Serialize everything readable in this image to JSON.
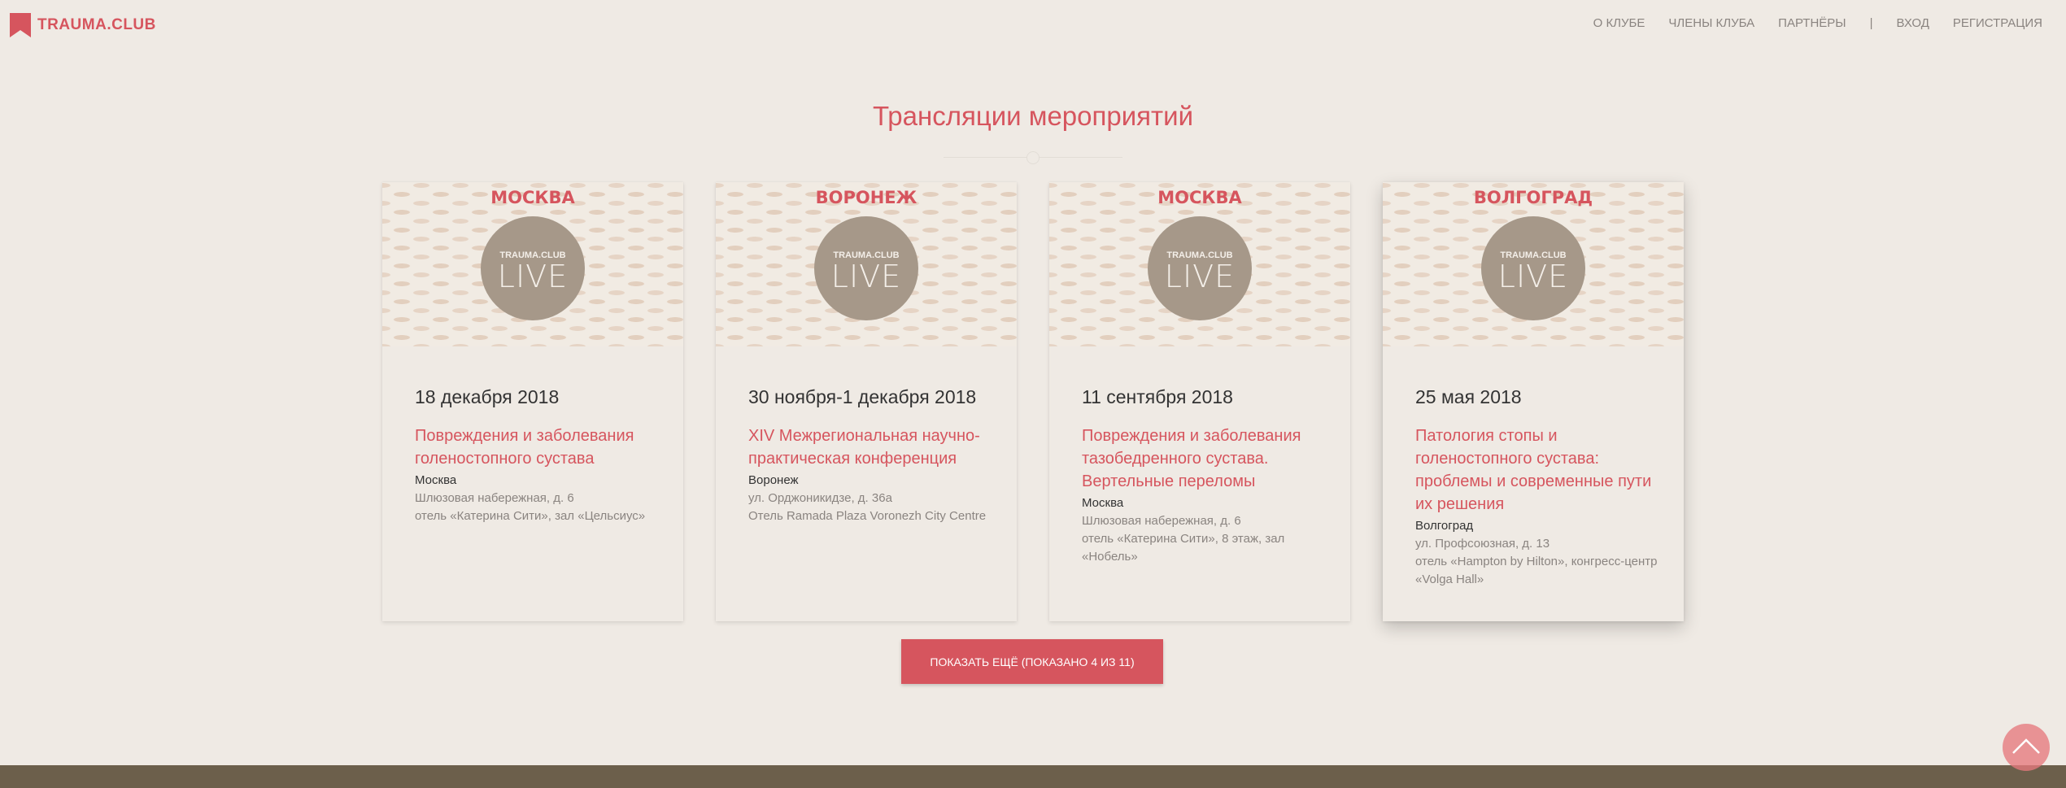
{
  "header": {
    "logo_text": "TRAUMA.CLUB",
    "logo_icon": "bookmark-icon",
    "nav": {
      "about": "О КЛУБЕ",
      "members": "ЧЛЕНЫ КЛУБА",
      "partners": "ПАРТНЁРЫ",
      "separator": "|",
      "login": "ВХОД",
      "register": "РЕГИСТРАЦИЯ"
    }
  },
  "main": {
    "title": "Трансляции мероприятий",
    "cards": [
      {
        "banner_city": "МОСКВА",
        "badge_brand": "TRAUMA.CLUB",
        "badge_live": "LIVE",
        "date": "18 декабря 2018",
        "title": "Повреждения и заболевания голеностопного сустава",
        "city": "Москва",
        "address_1": "Шлюзовая набережная, д. 6",
        "address_2": "отель «Катерина Сити», зал «Цельсиус»"
      },
      {
        "banner_city": "ВОРОНЕЖ",
        "badge_brand": "TRAUMA.CLUB",
        "badge_live": "LIVE",
        "date": "30 ноября-1 декабря 2018",
        "title": "XIV Межрегиональная научно-практическая конференция",
        "city": "Воронеж",
        "address_1": "ул. Орджоникидзе, д. 36а",
        "address_2": "Отель Ramada Plaza Voronezh City Centre"
      },
      {
        "banner_city": "МОСКВА",
        "badge_brand": "TRAUMA.CLUB",
        "badge_live": "LIVE",
        "date": "11 сентября 2018",
        "title": "Повреждения и заболевания тазобедренного сустава. Вертельные переломы",
        "city": "Москва",
        "address_1": "Шлюзовая набережная, д. 6",
        "address_2": "отель «Катерина Сити», 8 этаж, зал «Нобель»"
      },
      {
        "banner_city": "ВОЛГОГРАД",
        "badge_brand": "TRAUMA.CLUB",
        "badge_live": "LIVE",
        "date": "25 мая 2018",
        "title": "Патология стопы и голеностопного сустава: проблемы и современные пути их решения",
        "city": "Волгоград",
        "address_1": "ул. Профсоюзная, д. 13",
        "address_2": "отель «Hampton by Hilton», конгресс-центр «Volga Hall»"
      }
    ],
    "show_more_label": "ПОКАЗАТЬ ЕЩЁ (ПОКАЗАНО 4 ИЗ 11)"
  },
  "scroll_top_icon": "chevron-up-icon",
  "colors": {
    "accent": "#d6555e",
    "background": "#efeae4",
    "footer": "#6c5f4b",
    "badge": "#a69889"
  }
}
